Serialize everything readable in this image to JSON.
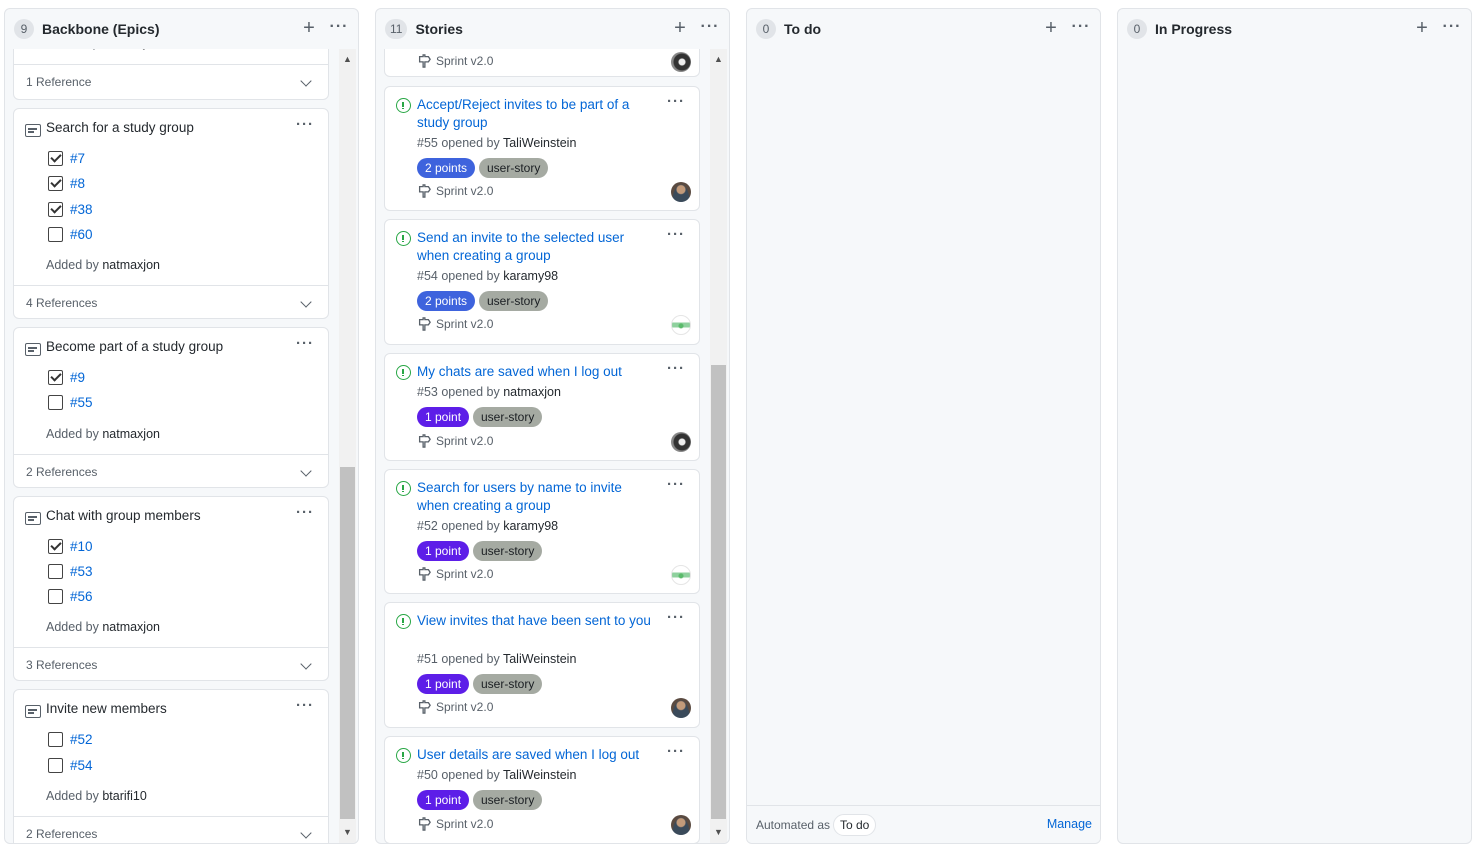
{
  "columns": {
    "backbone": {
      "count": "9",
      "title": "Backbone (Epics)",
      "partial_added_by": "natmaxjon",
      "partial_references": "1 Reference",
      "notes": [
        {
          "title": "Search for a study group",
          "items": [
            {
              "ref": "#7",
              "checked": true
            },
            {
              "ref": "#8",
              "checked": true
            },
            {
              "ref": "#38",
              "checked": true
            },
            {
              "ref": "#60",
              "checked": false
            }
          ],
          "added_prefix": "Added by",
          "added_by": "natmaxjon",
          "references": "4 References"
        },
        {
          "title": "Become part of a study group",
          "items": [
            {
              "ref": "#9",
              "checked": true
            },
            {
              "ref": "#55",
              "checked": false
            }
          ],
          "added_prefix": "Added by",
          "added_by": "natmaxjon",
          "references": "2 References"
        },
        {
          "title": "Chat with group members",
          "items": [
            {
              "ref": "#10",
              "checked": true
            },
            {
              "ref": "#53",
              "checked": false
            },
            {
              "ref": "#56",
              "checked": false
            }
          ],
          "added_prefix": "Added by",
          "added_by": "natmaxjon",
          "references": "3 References"
        },
        {
          "title": "Invite new members",
          "items": [
            {
              "ref": "#52",
              "checked": false
            },
            {
              "ref": "#54",
              "checked": false
            }
          ],
          "added_prefix": "Added by",
          "added_by": "btarifi10",
          "references": "2 References"
        }
      ]
    },
    "stories": {
      "count": "11",
      "title": "Stories",
      "partial_milestone": "Sprint v2.0",
      "cards": [
        {
          "title": "Accept/Reject invites to be part of a study group",
          "number": "#55",
          "opened_text": "opened by",
          "author": "TaliWeinstein",
          "points": "2 points",
          "label": "user-story",
          "milestone": "Sprint v2.0",
          "avatar": "person"
        },
        {
          "title": "Send an invite to the selected user when creating a group",
          "number": "#54",
          "opened_text": "opened by",
          "author": "karamy98",
          "points": "2 points",
          "label": "user-story",
          "milestone": "Sprint v2.0",
          "avatar": "green"
        },
        {
          "title": "My chats are saved when I log out",
          "number": "#53",
          "opened_text": "opened by",
          "author": "natmaxjon",
          "points": "1 point",
          "label": "user-story",
          "milestone": "Sprint v2.0",
          "avatar": "dark"
        },
        {
          "title": "Search for users by name to invite when creating a group",
          "number": "#52",
          "opened_text": "opened by",
          "author": "karamy98",
          "points": "1 point",
          "label": "user-story",
          "milestone": "Sprint v2.0",
          "avatar": "green"
        },
        {
          "title": "View invites that have been sent to you",
          "number": "#51",
          "opened_text": "opened by",
          "author": "TaliWeinstein",
          "points": "1 point",
          "label": "user-story",
          "milestone": "Sprint v2.0",
          "avatar": "person"
        },
        {
          "title": "User details are saved when I log out",
          "number": "#50",
          "opened_text": "opened by",
          "author": "TaliWeinstein",
          "points": "1 point",
          "label": "user-story",
          "milestone": "Sprint v2.0",
          "avatar": "person"
        }
      ]
    },
    "todo": {
      "count": "0",
      "title": "To do",
      "automated_text": "Automated as",
      "automated_badge": "To do",
      "manage_label": "Manage"
    },
    "inprogress": {
      "count": "0",
      "title": "In Progress"
    }
  },
  "icons": {
    "add": "plus-icon",
    "menu": "kebab-icon",
    "note": "note-icon",
    "issue": "issue-opened-icon",
    "milestone": "milestone-icon",
    "expand": "chevron-down-icon"
  },
  "colors": {
    "points_2": "#3e63dd",
    "points_1": "#5d1ee8",
    "user_story": "#a5aaa2",
    "link": "#0366d6",
    "issue_open": "#28a745"
  },
  "scrollbars": {
    "backbone_position": 0.82,
    "stories_position": 0.65
  }
}
